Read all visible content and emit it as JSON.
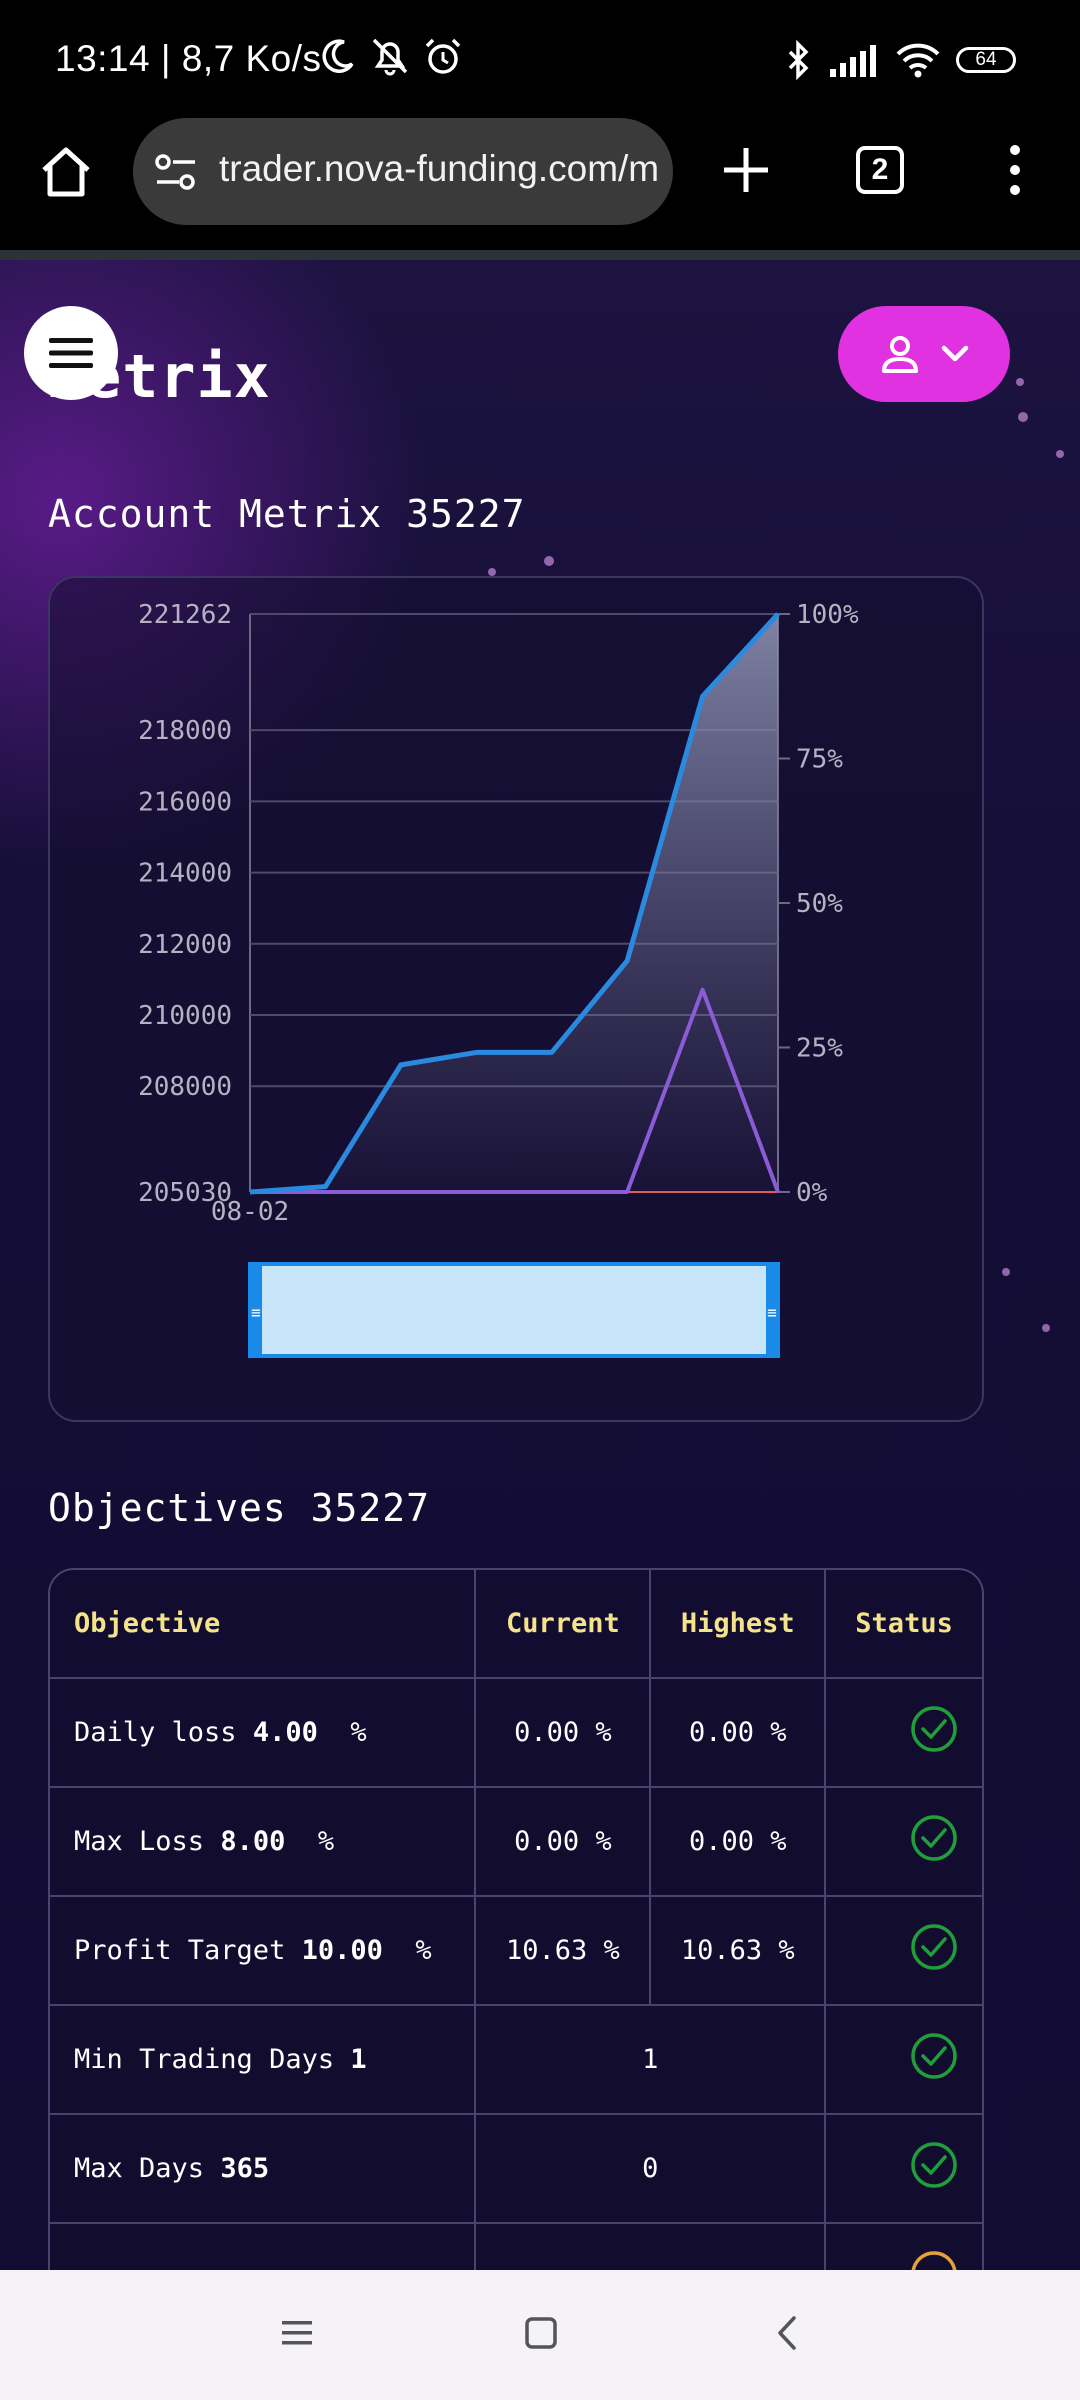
{
  "status_bar": {
    "time_speed": "13:14 | 8,7 Ko/s",
    "battery": "64"
  },
  "browser": {
    "url": "trader.nova-funding.com/metrix",
    "tab_count": "2"
  },
  "page": {
    "title": "Metrix",
    "account_heading": "Account Metrix 35227",
    "objectives_heading": "Objectives 35227"
  },
  "colors": {
    "accent_magenta": "#e032e0",
    "balance_line": "#2a8ae0",
    "secondary_line": "#8a5cd8",
    "heading_yellow": "#f4e38a",
    "status_green": "#1f9e3a"
  },
  "chart_data": {
    "type": "line",
    "x_start_label": "08-02",
    "left_axis": {
      "ticks": [
        "221262",
        "218000",
        "216000",
        "214000",
        "212000",
        "210000",
        "208000",
        "205030"
      ],
      "ylim": [
        205030,
        221262
      ]
    },
    "right_axis": {
      "ticks": [
        "100%",
        "75%",
        "50%",
        "25%",
        "0%"
      ],
      "ylim": [
        0,
        100
      ]
    },
    "x": [
      0,
      1,
      2,
      3,
      4,
      5,
      6,
      7
    ],
    "series": [
      {
        "axis": "left",
        "values": [
          205030,
          205180,
          208600,
          208950,
          208950,
          211520,
          218950,
          221262
        ]
      },
      {
        "axis": "right",
        "values": [
          0,
          0,
          0,
          0,
          0,
          0,
          35,
          0
        ]
      }
    ],
    "grid": true
  },
  "table": {
    "headers": [
      "Objective",
      "Current",
      "Highest",
      "Status"
    ],
    "rows": [
      {
        "label": "Daily loss ",
        "bold": "4.00",
        "unit": "  %",
        "current": "0.00 %",
        "highest": "0.00 %",
        "status": "passed"
      },
      {
        "label": "Max Loss ",
        "bold": "8.00",
        "unit": "  %",
        "current": "0.00 %",
        "highest": "0.00 %",
        "status": "passed"
      },
      {
        "label": "Profit Target ",
        "bold": "10.00",
        "unit": "  %",
        "current": "10.63 %",
        "highest": "10.63 %",
        "status": "passed"
      },
      {
        "label": "Min Trading Days ",
        "bold": "1",
        "unit": "",
        "merged": "1",
        "status": "passed"
      },
      {
        "label": "Max Days ",
        "bold": "365",
        "unit": "",
        "merged": "0",
        "status": "passed"
      }
    ]
  }
}
